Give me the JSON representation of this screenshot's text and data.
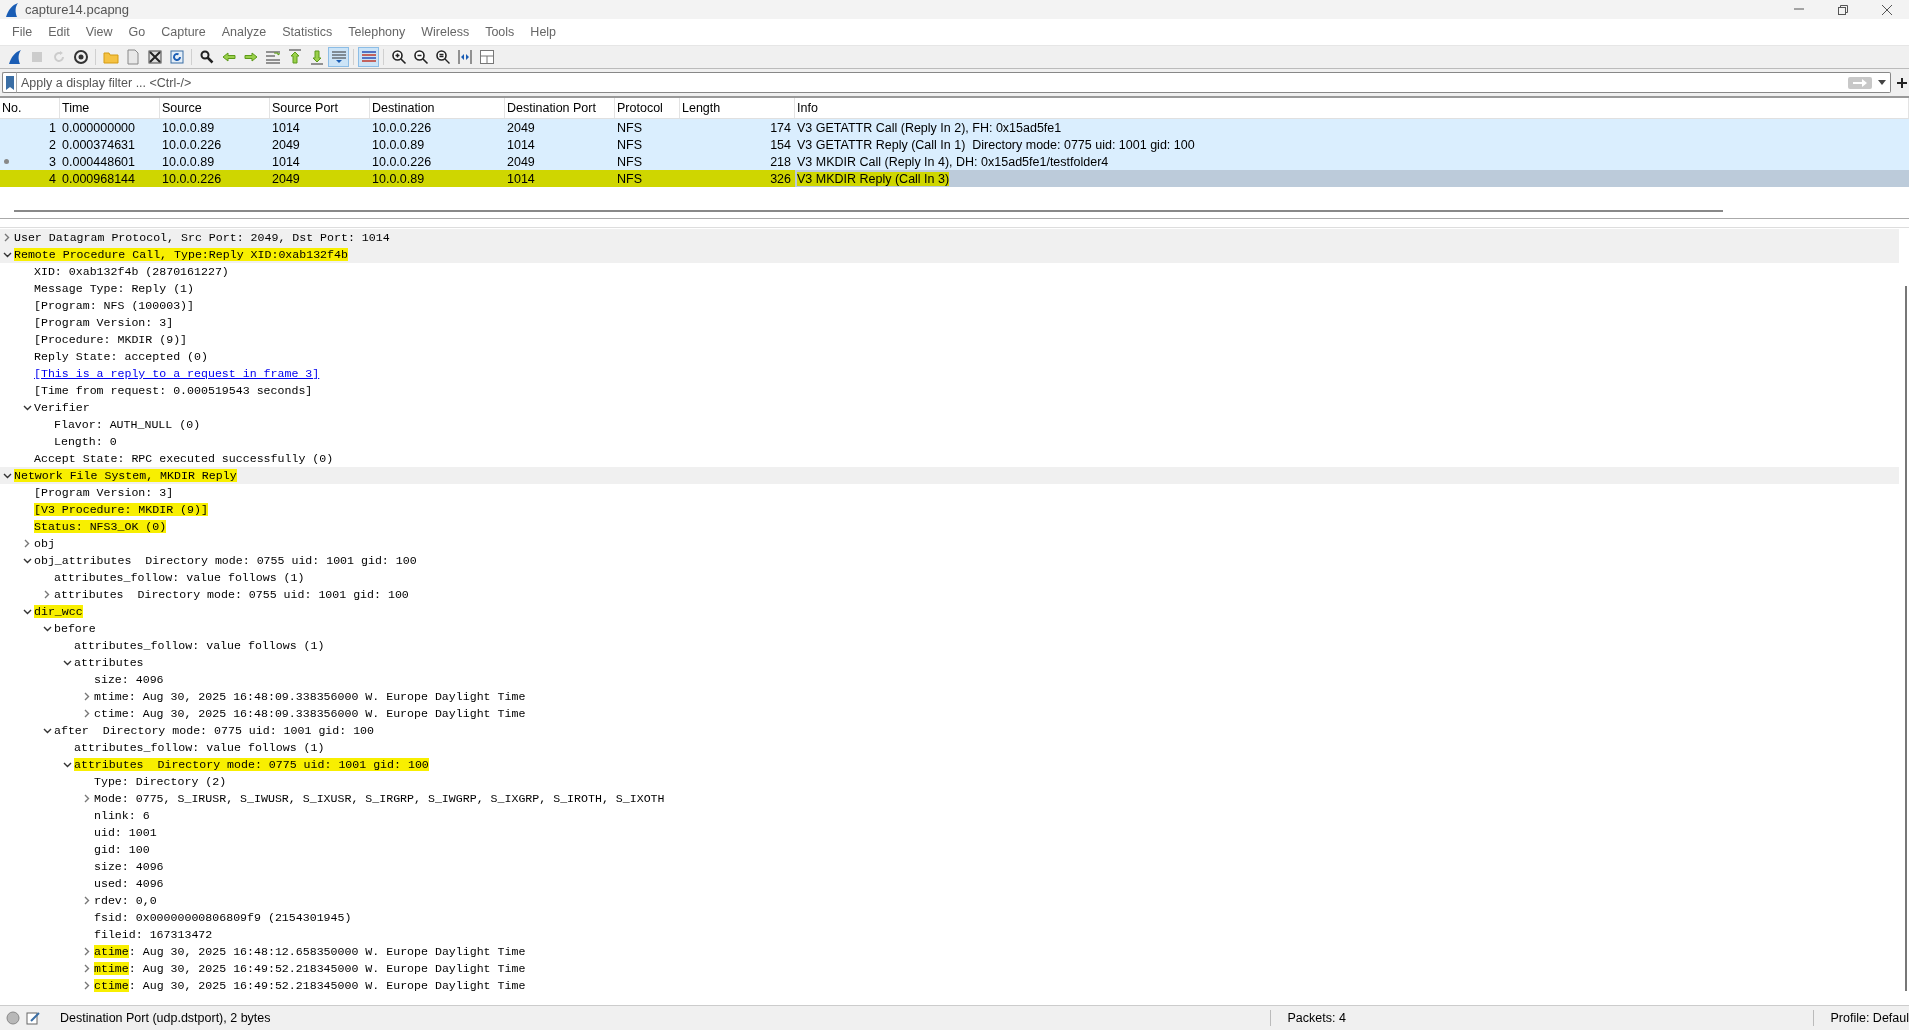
{
  "window": {
    "title": "capture14.pcapng"
  },
  "menu": [
    "File",
    "Edit",
    "View",
    "Go",
    "Capture",
    "Analyze",
    "Statistics",
    "Telephony",
    "Wireless",
    "Tools",
    "Help"
  ],
  "toolbar_buttons": [
    {
      "pressed": false,
      "disabled": false
    },
    {
      "pressed": false,
      "disabled": true
    },
    {
      "pressed": false,
      "disabled": true
    },
    {
      "pressed": false,
      "disabled": false
    },
    {
      "pressed": false,
      "disabled": false
    },
    {
      "pressed": false,
      "disabled": false
    },
    {
      "pressed": false,
      "disabled": false
    },
    {
      "pressed": false,
      "disabled": false
    },
    {
      "pressed": false,
      "disabled": false
    },
    {
      "pressed": false,
      "disabled": false
    },
    {
      "pressed": false,
      "disabled": false
    },
    {
      "pressed": false,
      "disabled": false
    },
    {
      "pressed": false,
      "disabled": false
    },
    {
      "pressed": false,
      "disabled": false
    },
    {
      "pressed": true,
      "disabled": false
    },
    {
      "pressed": true,
      "disabled": false
    },
    {
      "pressed": false,
      "disabled": false
    },
    {
      "pressed": false,
      "disabled": false
    },
    {
      "pressed": false,
      "disabled": false
    },
    {
      "pressed": false,
      "disabled": false
    },
    {
      "pressed": false,
      "disabled": false
    }
  ],
  "filter": {
    "placeholder": "Apply a display filter ... <Ctrl-/>"
  },
  "packet_list": {
    "columns": [
      "No.",
      "Time",
      "Source",
      "Source Port",
      "Destination",
      "Destination Port",
      "Protocol",
      "Length",
      "Info"
    ],
    "rows": [
      {
        "cells": [
          "1",
          "0.000000000",
          "10.0.0.89",
          "1014",
          "10.0.0.226",
          "2049",
          "NFS",
          "174",
          "V3 GETATTR Call (Reply In 2), FH: 0x15ad5fe1"
        ],
        "selected": false,
        "highlighted": false,
        "related": false
      },
      {
        "cells": [
          "2",
          "0.000374631",
          "10.0.0.226",
          "2049",
          "10.0.0.89",
          "1014",
          "NFS",
          "154",
          "V3 GETATTR Reply (Call In 1)  Directory mode: 0775 uid: 1001 gid: 100"
        ],
        "selected": false,
        "highlighted": false,
        "related": false
      },
      {
        "cells": [
          "3",
          "0.000448601",
          "10.0.0.89",
          "1014",
          "10.0.0.226",
          "2049",
          "NFS",
          "218",
          "V3 MKDIR Call (Reply In 4), DH: 0x15ad5fe1/testfolder4"
        ],
        "selected": false,
        "highlighted": false,
        "related": true
      },
      {
        "cells": [
          "4",
          "0.000968144",
          "10.0.0.226",
          "2049",
          "10.0.0.89",
          "1014",
          "NFS",
          "326",
          "V3 MKDIR Reply (Call In 3)"
        ],
        "selected": true,
        "highlighted": true,
        "related": false
      }
    ]
  },
  "tree": [
    {
      "text": "User Datagram Protocol, Src Port: 2049, Dst Port: 1014",
      "expanded": false
    },
    {
      "text": "Remote Procedure Call, Type:Reply XID:0xab132f4b",
      "expanded": true,
      "highlighted": true,
      "children": [
        {
          "text": "XID: 0xab132f4b (2870161227)"
        },
        {
          "text": "Message Type: Reply (1)"
        },
        {
          "text": "[Program: NFS (100003)]"
        },
        {
          "text": "[Program Version: 3]"
        },
        {
          "text": "[Procedure: MKDIR (9)]"
        },
        {
          "text": "Reply State: accepted (0)"
        },
        {
          "text": "[This is a reply to a request in frame 3]",
          "kind": "link"
        },
        {
          "text": "[Time from request: 0.000519543 seconds]"
        },
        {
          "text": "Verifier",
          "expanded": true,
          "children": [
            {
              "text": "Flavor: AUTH_NULL (0)"
            },
            {
              "text": "Length: 0"
            }
          ]
        },
        {
          "text": "Accept State: RPC executed successfully (0)"
        }
      ]
    },
    {
      "text": "Network File System, MKDIR Reply",
      "expanded": true,
      "highlighted": true,
      "children": [
        {
          "text": "[Program Version: 3]"
        },
        {
          "text": "[V3 Procedure: MKDIR (9)]",
          "highlighted": true
        },
        {
          "text": "Status: NFS3_OK (0)",
          "highlighted": true
        },
        {
          "text": "obj",
          "expanded": false
        },
        {
          "text": "obj_attributes  Directory mode: 0755 uid: 1001 gid: 100",
          "expanded": true,
          "children": [
            {
              "text": "attributes_follow: value follows (1)"
            },
            {
              "text": "attributes  Directory mode: 0755 uid: 1001 gid: 100",
              "expanded": false
            }
          ]
        },
        {
          "text": "dir_wcc",
          "expanded": true,
          "highlighted": true,
          "children": [
            {
              "text": "before",
              "expanded": true,
              "children": [
                {
                  "text": "attributes_follow: value follows (1)"
                },
                {
                  "text": "attributes",
                  "expanded": true,
                  "children": [
                    {
                      "text": "size: 4096"
                    },
                    {
                      "text": "mtime: Aug 30, 2025 16:48:09.338356000 W. Europe Daylight Time",
                      "expanded": false
                    },
                    {
                      "text": "ctime: Aug 30, 2025 16:48:09.338356000 W. Europe Daylight Time",
                      "expanded": false
                    }
                  ]
                }
              ]
            },
            {
              "text": "after  Directory mode: 0775 uid: 1001 gid: 100",
              "expanded": true,
              "children": [
                {
                  "text": "attributes_follow: value follows (1)"
                },
                {
                  "text": "attributes  Directory mode: 0775 uid: 1001 gid: 100",
                  "expanded": true,
                  "highlighted": true,
                  "children": [
                    {
                      "text": "Type: Directory (2)"
                    },
                    {
                      "text": "Mode: 0775, S_IRUSR, S_IWUSR, S_IXUSR, S_IRGRP, S_IWGRP, S_IXGRP, S_IROTH, S_IXOTH",
                      "expanded": false
                    },
                    {
                      "text": "nlink: 6"
                    },
                    {
                      "text": "uid: 1001"
                    },
                    {
                      "text": "gid: 100"
                    },
                    {
                      "text": "size: 4096"
                    },
                    {
                      "text": "used: 4096"
                    },
                    {
                      "text": "rdev: 0,0",
                      "expanded": false
                    },
                    {
                      "text": "fsid: 0x00000000806809f9 (2154301945)"
                    },
                    {
                      "text": "fileid: 167313472"
                    },
                    {
                      "text": "atime: Aug 30, 2025 16:48:12.658350000 W. Europe Daylight Time",
                      "expanded": false,
                      "label_highlighted": true
                    },
                    {
                      "text": "mtime: Aug 30, 2025 16:49:52.218345000 W. Europe Daylight Time",
                      "expanded": false,
                      "label_highlighted": true
                    },
                    {
                      "text": "ctime: Aug 30, 2025 16:49:52.218345000 W. Europe Daylight Time",
                      "expanded": false,
                      "label_highlighted": true
                    }
                  ]
                }
              ]
            }
          ]
        }
      ]
    }
  ],
  "status_bar": {
    "field_info": "Destination Port (udp.dstport), 2 bytes",
    "packets": "Packets: 4",
    "profile": "Profile: Defaul"
  }
}
